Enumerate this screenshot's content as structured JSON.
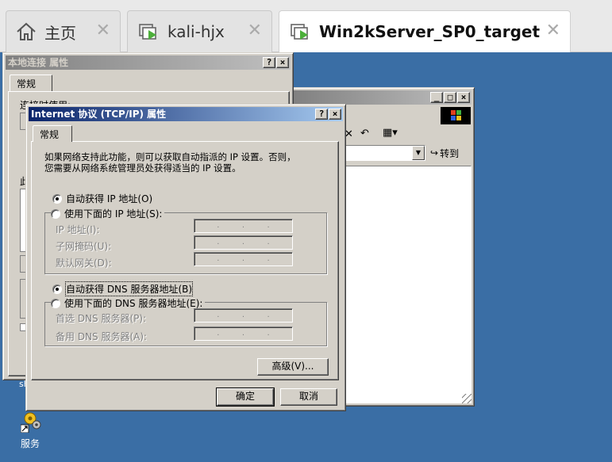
{
  "vm_tabs": [
    {
      "label": "主页",
      "icon": "home-icon"
    },
    {
      "label": "kali-hjx",
      "icon": "vm-running-icon"
    },
    {
      "label": "Win2kServer_SP0_target",
      "icon": "vm-running-icon"
    }
  ],
  "local_conn": {
    "title": "本地连接 属性",
    "tab": "常规",
    "connect_using": "连接时使用:",
    "this_conn_label": "此",
    "help_btn": "?",
    "close_btn": "×"
  },
  "explorer": {
    "go_label": "转到",
    "min_btn": "_",
    "max_btn": "□",
    "close_btn": "×"
  },
  "tcpip": {
    "title": "Internet 协议 (TCP/IP) 属性",
    "help_btn": "?",
    "close_btn": "×",
    "tab": "常规",
    "description_line1": "如果网络支持此功能，则可以获取自动指派的 IP 设置。否则，",
    "description_line2": "您需要从网络系统管理员处获得适当的 IP 设置。",
    "auto_ip": "自动获得 IP 地址(O)",
    "manual_ip": "使用下面的 IP 地址(S):",
    "ip_address": "IP 地址(I):",
    "subnet_mask": "子网掩码(U):",
    "default_gateway": "默认网关(D):",
    "auto_dns": "自动获得 DNS 服务器地址(B)",
    "manual_dns": "使用下面的 DNS 服务器地址(E):",
    "preferred_dns": "首选 DNS 服务器(P):",
    "alternate_dns": "备用 DNS 服务器(A):",
    "ip_dot": ".",
    "advanced_btn": "高级(V)...",
    "ok_btn": "确定",
    "cancel_btn": "取消"
  },
  "desktop": {
    "partial_label": "sh",
    "services_icon_label": "服务"
  },
  "colors": {
    "desktop": "#3a6ea5",
    "title_active": "#0a246a",
    "title_inactive": "#808080",
    "face": "#d4d0c8",
    "vm_play": "#4caf3a"
  }
}
